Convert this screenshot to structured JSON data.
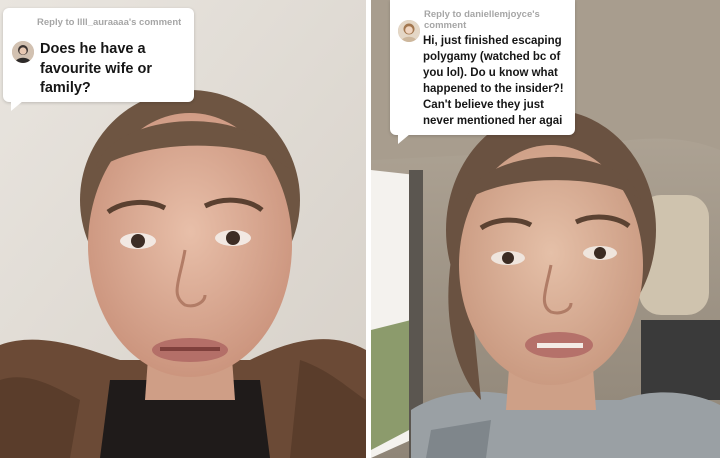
{
  "left_video": {
    "reply_label": "Reply to llll_auraaaa's comment",
    "comment_lines": [
      "Does he have a",
      "favourite wife or",
      "family?"
    ]
  },
  "right_video": {
    "reply_label_line1": "Reply to daniellemjoyce's",
    "reply_label_line2": "comment",
    "comment_lines": [
      "Hi, just finished escaping",
      "polygamy (watched bc of",
      "you lol). Do u know what",
      "happened to the insider?!",
      "Can't believe they just",
      "never mentioned her agai"
    ]
  }
}
